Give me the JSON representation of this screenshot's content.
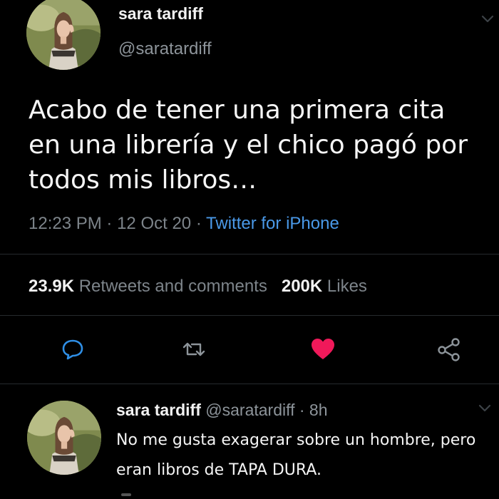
{
  "tweet": {
    "display_name": "sara tardiff",
    "handle": "@saratardiff",
    "text": "Acabo de tener una primera cita en una librería y el chico pagó por todos mis libros…",
    "time": "12:23 PM",
    "date": "12 Oct 20",
    "source": "Twitter for iPhone",
    "separator": "·",
    "retweets_count": "23.9K",
    "retweets_label": "Retweets and comments",
    "likes_count": "200K",
    "likes_label": "Likes",
    "liked": true
  },
  "reply": {
    "display_name": "sara tardiff",
    "handle": "@saratardiff",
    "separator": "·",
    "age": "8h",
    "text": "No me gusta exagerar sobre un hombre, pero eran libros de TAPA DURA."
  },
  "icons": {
    "reply": "reply-bubble-icon",
    "retweet": "retweet-icon",
    "like": "heart-icon",
    "share": "share-icon",
    "menu": "chevron-down-icon"
  },
  "colors": {
    "background": "#000000",
    "link": "#4a99e8",
    "like": "#f0195a",
    "muted": "#7d848a"
  }
}
